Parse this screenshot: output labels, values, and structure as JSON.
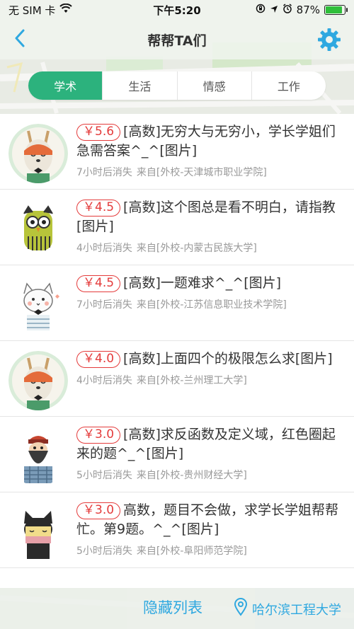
{
  "status_bar": {
    "carrier": "无 SIM 卡",
    "time": "下午5:20",
    "battery_text": "87%",
    "battery_level": 0.87,
    "icons": [
      "wifi-icon",
      "orientation-lock-icon",
      "location-arrow-icon",
      "alarm-icon",
      "battery-icon"
    ]
  },
  "nav": {
    "title": "帮帮TA们",
    "back_icon": "chevron-left-icon",
    "settings_icon": "gear-icon"
  },
  "tabs": [
    {
      "label": "学术",
      "active": true
    },
    {
      "label": "生活",
      "active": false
    },
    {
      "label": "情感",
      "active": false
    },
    {
      "label": "工作",
      "active": false
    }
  ],
  "items": [
    {
      "price": "￥5.6",
      "title": "[高数]无穷大与无穷小，学长学姐们 急需答案^_^[图片]",
      "time": "7小时后消失",
      "source": "来自[外校-天津城市职业学院]",
      "avatar": "deer-avatar"
    },
    {
      "price": "￥4.5",
      "title": "[高数]这个图总是看不明白，请指教[图片]",
      "time": "4小时后消失",
      "source": "来自[外校-内蒙古民族大学]",
      "avatar": "owl-avatar"
    },
    {
      "price": "￥4.5",
      "title": "[高数]一题难求^_^[图片]",
      "time": "7小时后消失",
      "source": "来自[外校-江苏信息职业技术学院]",
      "avatar": "cat-avatar"
    },
    {
      "price": "￥4.0",
      "title": "[高数]上面四个的极限怎么求[图片]",
      "time": "4小时后消失",
      "source": "来自[外校-兰州理工大学]",
      "avatar": "deer-avatar"
    },
    {
      "price": "￥3.0",
      "title": "[高数]求反函数及定义域，红色圈起来的题^_^[图片]",
      "time": "5小时后消失",
      "source": "来自[外校-贵州财经大学]",
      "avatar": "bearded-man-avatar"
    },
    {
      "price": "￥3.0",
      "title": "高数，题目不会做，求学长学姐帮帮忙。第9题。^_^[图片]",
      "time": "5小时后消失",
      "source": "来自[外校-阜阳师范学院]",
      "avatar": "cat-girl-avatar"
    }
  ],
  "bottom": {
    "hide_label": "隐藏列表",
    "location_label": "哈尔滨工程大学",
    "location_icon": "location-pin-icon"
  },
  "colors": {
    "accent_green": "#2cb27d",
    "link_blue": "#2fa8e0",
    "price_red": "#e43b3b"
  }
}
